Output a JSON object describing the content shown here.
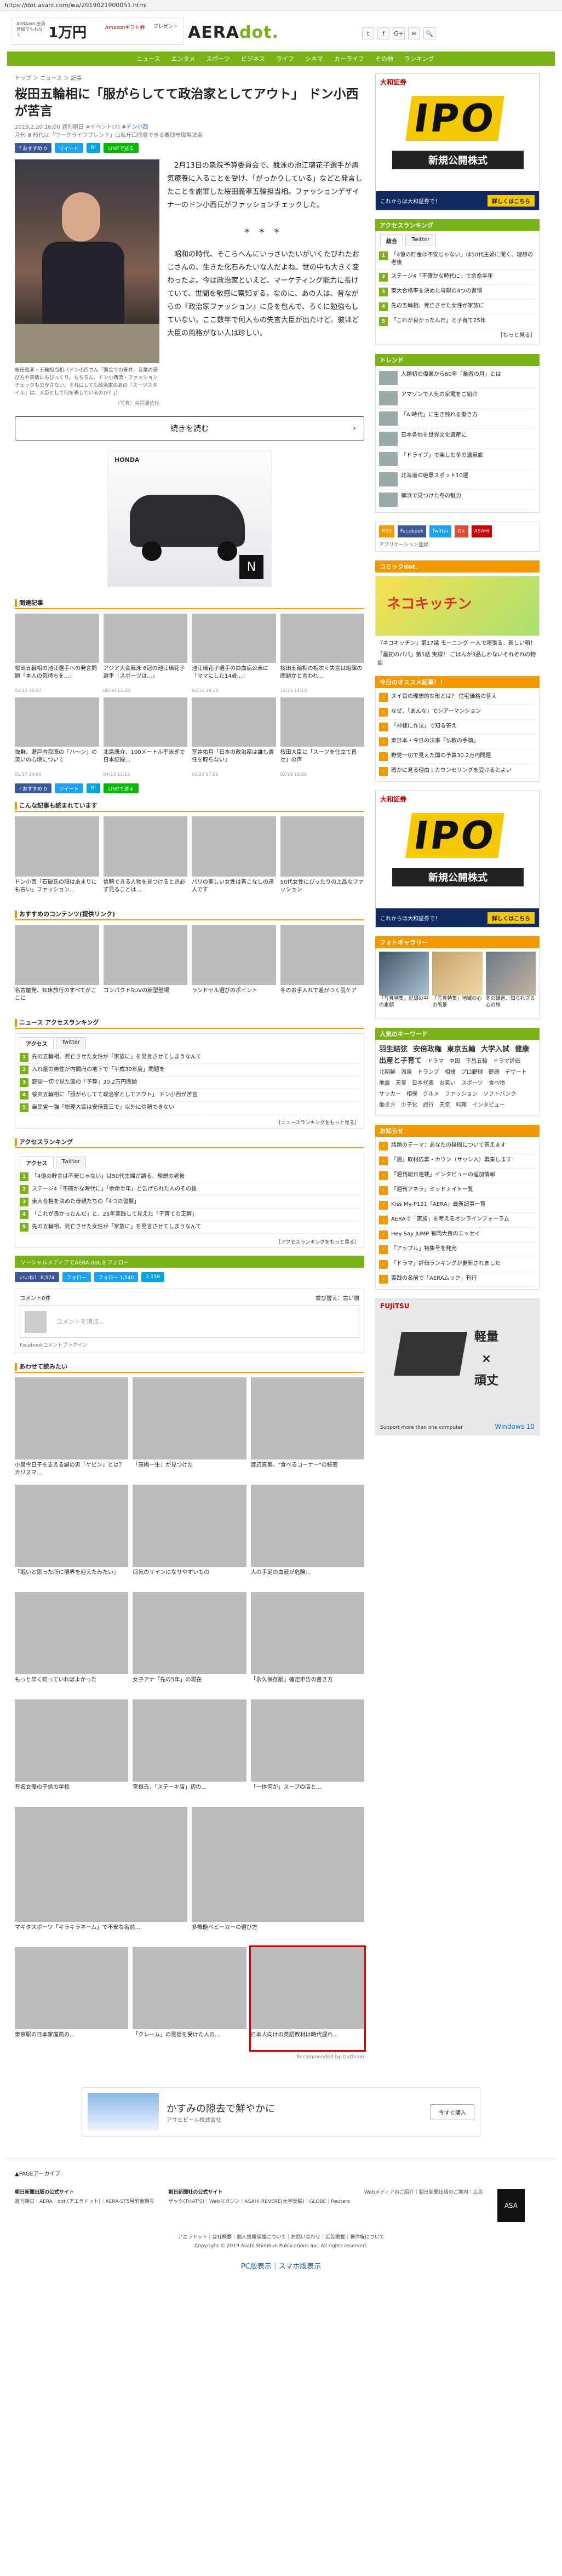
{
  "browser": {
    "url": "https://dot.asahi.com/wa/2019021900051.html"
  },
  "header": {
    "promo_small": "AERAdot.会員登録でもれなく",
    "promo_yen": "1万円",
    "promo_mid": "Amazonギフト券",
    "promo_right": "プレゼント",
    "logo_main": "AERA",
    "logo_dot": "dot.",
    "social": [
      "t",
      "f",
      "G+",
      "✉",
      "🔍"
    ]
  },
  "gnav": [
    "ニュース",
    "エンタメ",
    "スポーツ",
    "ビジネス",
    "ライフ",
    "シネマ",
    "カーライフ",
    "その他",
    "ランキング"
  ],
  "article": {
    "breadcrumb": "トップ ＞ ニュース ＞ 記事",
    "title": "桜田五輪相に「服がらしてて政治家としてアウト」 ドン小西が苦言",
    "date": "2019.2.20 16:00 週刊朝日 #イベント(7)",
    "series": "#ドン小西",
    "sub": "月刊 Ⅲ 時代は「ワークライフブレンド」山私斤口同意できる要団市職場法案",
    "share": [
      "f おすすめ 0",
      "ツイート",
      "B!",
      "LINEで送る"
    ],
    "caption": "桜田義孝・五輪担当相（ドン小西さん「国会での答弁、言葉の選び方や表情にもびっくり。もちろん、ドン小西流・ファッションチェックも欠かさない。それにしても政治家のあの『スーツスタイル』は、大臣として何を表しているのか？」）",
    "credit": "（写真）共同通信社",
    "para1": "2月13日の衆院予算委員会で、競泳の池江璃花子選手が病気療養に入ることを受け、「がっかりしている」などと発言したことを謝罪した桜田義孝五輪担当相。ファッションデザイナーのドン小西氏がファッションチェックした。",
    "stars": "＊＊＊",
    "para2": "昭和の時代、そこらへんにいっさいたいがいくたびれたおじさんの、生きた化石みたいな人だよね。世の中も大きく変わったよ。今は政治家といえど、マーケティング能力に長けていて、世間を敏感に察知する。なのに、あの人は、昔ながらの『政治家ファッション』に身を包んで、ろくに勉強もしていない。ここ数年で何人もの失言大臣が出たけど、彼ほど大臣の風格がない人は珍しい。",
    "readmore": "続きを読む"
  },
  "ad_car": {
    "brand": "HONDA",
    "mark": "N"
  },
  "related": {
    "heading": "関連記事",
    "items": [
      {
        "cap": "桜田五輪相の池江選手への発言問題「本人の気持ちを...」",
        "date": "02/13 16:47"
      },
      {
        "cap": "アジア大会競泳 6冠の池江璃花子選手「スポーツは...」",
        "date": "08/30 11:20"
      },
      {
        "cap": "池江璃花子選手の白血病公表に「ママにした14歳...」",
        "date": "02/12 18:20"
      },
      {
        "cap": "桜田五輪相の相次ぐ失言は組織の問題かと言われ...",
        "date": "11/13 14:10"
      },
      {
        "cap": "抜群、瀬戸内寂聴の「ハ～ン」の笑いの心境について",
        "date": "01/17 14:00"
      },
      {
        "cap": "北島康介、100メートル平泳ぎで日本記録...",
        "date": "04/13 11:12"
      },
      {
        "cap": "室井佑月「日本の政治家は誰も責任を取らない」",
        "date": "02/20 07:00"
      },
      {
        "cap": "桜田大臣に「スーツを仕立て直せ」の声",
        "date": "02/19 16:00"
      }
    ]
  },
  "recommend": {
    "heading": "こんな記事も読まれています",
    "items": [
      {
        "cap": "ドン小西「石破氏の服はあまりにも古い」ファッション..."
      },
      {
        "cap": "信頼できる人物を見つけるとき必ず見ることは..."
      },
      {
        "cap": "パリの美しい女性は着こなしの達人です"
      },
      {
        "cap": "50代女性にぴったりの上品なファッション"
      }
    ],
    "content_heading": "おすすめのコンテンツ(提供リンク)",
    "content": [
      {
        "cap": "名古屋発、知床旅行のすべてがここに"
      },
      {
        "cap": "コンパクトSUVの新型登場"
      },
      {
        "cap": "ランドセル選びのポイント"
      },
      {
        "cap": "冬のお手入れで差がつく肌ケア"
      }
    ]
  },
  "news_rank": {
    "heading": "ニュース アクセスランキング",
    "tabs": [
      "アクセス",
      "Twitter"
    ],
    "items": [
      "先の五輪相、死亡させた女性が「家族に」を発言させてしまうなんて",
      "入れ墨の男性が内閣府の地下で「平成30年度」問題を",
      "野党一切で見た国の「予算」30.2万円問題",
      "桜田五輪相に「服がらしてて政治家としてアウト」 ドン小西が苦言",
      "自民党一強「総理大臣は安倍晋三で」以外に信頼できない"
    ],
    "more": "［ニュースランキングをもっと見る］"
  },
  "access_rank": {
    "heading": "アクセスランキング",
    "tabs": [
      "アクセス",
      "Twitter"
    ],
    "items": [
      "「4億の貯金は不安じゃない」は50代主婦が語る、理想の老後",
      "ステージ4「不確かな時代に」「余命半年」と告げられた人のその後",
      "東大合格を決めた母親たちの「4つの習慣」",
      "「これが良かったんだ」と、25年実践して見えた「子育ての正解」",
      "先の五輪相、死亡させた女性が「家族に」を発言させてしまうなんて"
    ],
    "more": "［アクセスランキングをもっと見る］"
  },
  "follow": {
    "heading": "ソーシャルメディアでAERA dot.をフォロー",
    "bar": [
      "いいね！ 8,574",
      "フォロー",
      "フォロー 1,540",
      "2,156"
    ]
  },
  "comments": {
    "count": "コメント0件",
    "sort": "並び替え：古い順",
    "placeholder": "コメントを追加...",
    "plugin": "Facebookコメントプラグイン"
  },
  "outbrain": {
    "heading": "あわせて読みたい",
    "row1": [
      {
        "cap": "小泉今日子を支える謎の男「ケビン」とは？カリスマ..."
      },
      {
        "cap": "「高嶋一生」が見つけた"
      },
      {
        "cap": "渡辺直美、\"食べるコーナー\"の秘密"
      }
    ],
    "row2": [
      {
        "cap": "「眠いと思った所に限界を迎えたみたい」"
      },
      {
        "cap": "病気のサインになりやすいもの"
      },
      {
        "cap": "人の手足の血液が危険..."
      }
    ],
    "row3": [
      {
        "cap": "もっと早く知っていればよかった"
      },
      {
        "cap": "女子アナ「先の5年」の現在"
      },
      {
        "cap": "「永久保存版」確定申告の書き方"
      }
    ],
    "row4": [
      {
        "cap": "有名女優の子供の学校"
      },
      {
        "cap": "宮根氏、「ステーキ店」初の..."
      },
      {
        "cap": "「一体何が」スープの店と..."
      }
    ],
    "row5": [
      {
        "cap": "マキタスポーツ「キラキラネーム」で不安な名前..."
      },
      {
        "cap": "多機能ベビーカーの選び方"
      }
    ],
    "row6": [
      {
        "cap": "東京駅の日本家屋風の..."
      },
      {
        "cap": "「クレーム」の電話を受けた人の..."
      },
      {
        "cap": "日本人向けの英語教材は時代遅れ..."
      }
    ],
    "by": "Recommended by Outbrain"
  },
  "sidebar": {
    "ipo": {
      "brand": "大和証券",
      "big": "IPO",
      "band": "新規公開株式",
      "foot": "これからは大和証券で！",
      "btn": "詳しくはこちら"
    },
    "ranking": {
      "heading": "アクセスランキング",
      "tabs": [
        "総合",
        "Twitter"
      ],
      "items": [
        "「4億の貯金は不安じゃない」は50代主婦に聞く、理想の老後",
        "ステージ4「不確かな時代に」で余命半年",
        "東大合格率を決めた母親の4つの習慣",
        "先の五輪相、死亡させた女性が家族に",
        "「これが良かったんだ」と子育て25年"
      ],
      "more": "［もっと見る］"
    },
    "trend": {
      "heading": "トレンド",
      "items": [
        "人類初の偉業から60年「業者の月」とは",
        "アマゾンで人気の家電をご紹介",
        "「AI時代」に生き残れる働き方",
        "日本各地を世界文化遺産に",
        "「ドライブ」で楽しむ冬の温泉旅",
        "北海道の絶景スポット10選",
        "横浜で見つけた冬の魅力"
      ]
    },
    "icons": [
      "RSS",
      "Facebook",
      "Twitter",
      "G+",
      "ASAHI"
    ],
    "icons_note": "アプリケーション登録",
    "comic": {
      "heading": "コミックdot.",
      "title": "ネコキッチン",
      "item1": "『ネコキッチン』第17話 モーニング 一人で頑張る、新しい朝！",
      "item2": "「最初のパパ」第5話 実録！ ごはんが3品しかないそれぞれの物語"
    },
    "recommend": {
      "heading": "今日のオススメ記事！！",
      "items": [
        "スイ首の理想的な形とは？ 住宅価格の答え",
        "なぜ、「あんな」でシアーマンション",
        "「神様に作法」で知る答え",
        "東日本・今日の法事「仏教の手順」",
        "野党一切で見えた国の予算30.2万円問題",
        "確かに見る理由 | カウンセリングを受けるとよい"
      ]
    },
    "ipo2": {
      "brand": "大和証券",
      "big": "IPO",
      "band": "新規公開株式",
      "foot": "これからは大和証券で！",
      "btn": "詳しくはこちら"
    },
    "photos": {
      "heading": "フォトギャラリー",
      "items": [
        "「写真特集」記録の中の素顔",
        "「写真特集」地域の心の風景",
        "冬の鎌倉、知られざる心の旅"
      ]
    },
    "keywords": {
      "heading": "人気のキーワード",
      "words": [
        "羽生結弦",
        "安倍政権",
        "東京五輪",
        "大学入試",
        "健康",
        "出産と子育て",
        "ドラマ",
        "中国",
        "平昌五輪",
        "ドラマ評価",
        "北朝鮮",
        "温泉",
        "トランプ",
        "相撲",
        "プロ野球",
        "健康",
        "デザート",
        "地震",
        "天皇",
        "日本代表",
        "お笑い",
        "スポーツ",
        "食べ物",
        "サッカー",
        "相撲",
        "グルメ",
        "ファッション",
        "ソフトバンク",
        "働き方",
        "少子化",
        "旅行",
        "天気",
        "料理",
        "インタビュー"
      ]
    },
    "notice": {
      "heading": "お知らせ",
      "items": [
        "話題のテーマ：あなたの疑問について答えます",
        "「週」取材応募・カウン（サッシ入）募集します！",
        "「週刊朝日連載」インタビューの追加情報",
        "「週刊アネラ」ミッドナイト一覧",
        "Kiss My-P121「AERA」最新記事一覧",
        "AERAで「家族」を考えるオンラインフォーラム",
        "Hey Say JUMP 有岡大貴のエッセイ",
        "「アップル」特集号を発売",
        "「ドラマ」評価ランキングが更新されました",
        "実践の名前で「AERAムック」刊行"
      ]
    },
    "win_ad": {
      "brand": "FUJITSU",
      "t1": "軽量",
      "t2": "×",
      "t3": "頑丈",
      "foot": "Support more than one computer",
      "win": "Windows 10"
    }
  },
  "bottom_ad": {
    "title": "かすみの隙去で鮮やかに",
    "company": "アサヒビール株式会社",
    "btn": "今すぐ購入"
  },
  "footer": {
    "pagetop": "▲PAGEアーカイブ",
    "col1_h": "朝日新聞出版の公式サイト",
    "col1": "週刊朝日｜AERA｜dot.(アエラドット)｜AERA-ST5月前後期号",
    "col2_h": "朝日新聞社の公式サイト",
    "col2": "ザッツ(THAT'S)｜Webマガジン｜ASAHI REVERE(大学受験)｜GLOBE｜Reuters",
    "col3_h": "",
    "col3": "Webメディアのご紹介｜朝日新聞出版のご案内｜広告",
    "logo": "ASA",
    "links": "アエラドット｜会社概要｜個人情報保護について｜お問い合わせ｜広告掲載｜著作権について",
    "copyright": "Copyright © 2019 Asahi Shimbun Publications Inc. All rights reserved.",
    "pcsp": "PC版表示｜スマホ版表示"
  }
}
